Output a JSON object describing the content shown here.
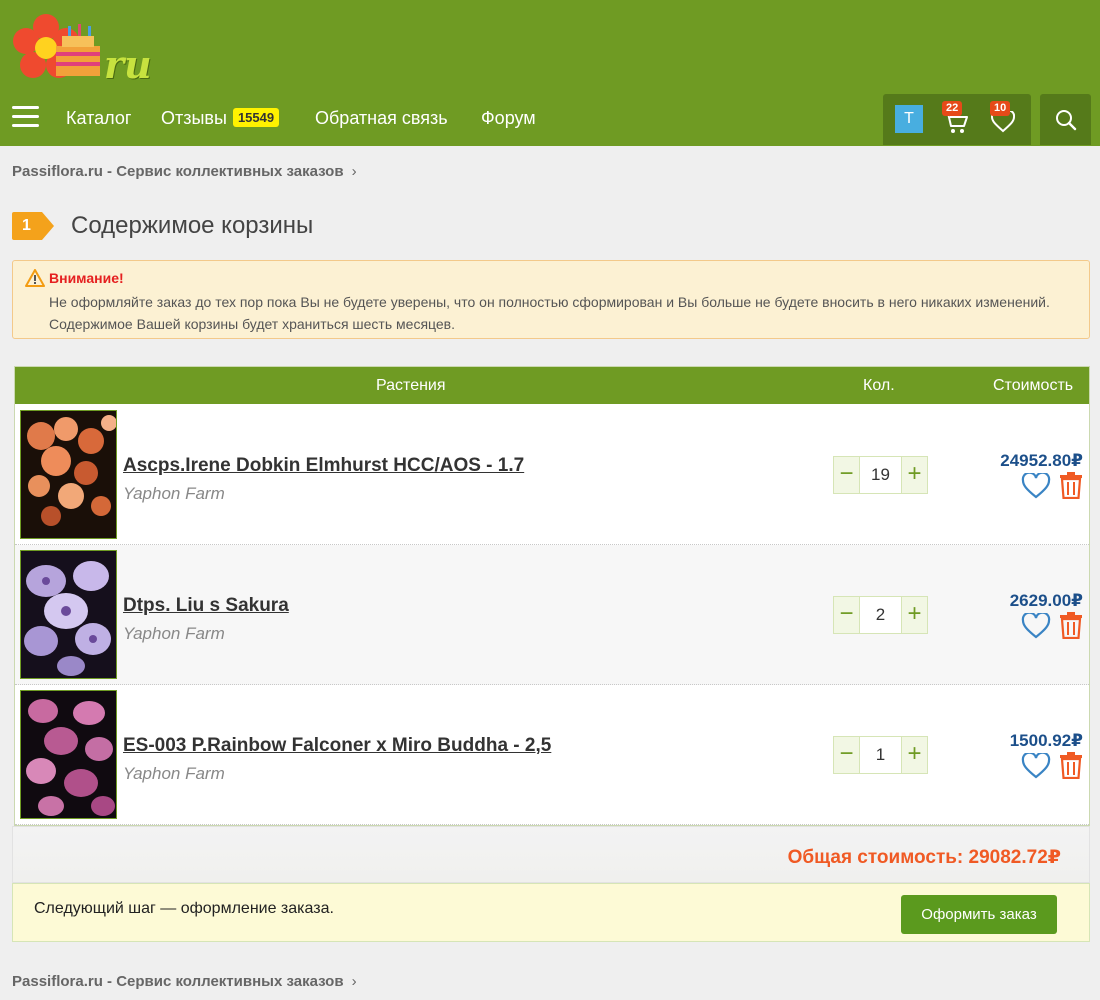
{
  "header": {
    "logo_text": "ru",
    "nav": {
      "catalog": "Каталог",
      "reviews": "Отзывы",
      "reviews_count": "15549",
      "feedback": "Обратная связь",
      "forum": "Форум"
    },
    "user_initial": "T",
    "cart_count": "22",
    "favorites_count": "10"
  },
  "breadcrumb": {
    "text": "Passiflora.ru - Сервис коллективных заказов",
    "sep": "›"
  },
  "step": {
    "number": "1",
    "title": "Содержимое корзины"
  },
  "warning": {
    "title": "Внимание!",
    "text": "Не оформляйте заказ до тех пор пока Вы не будете уверены, что он полностью сформирован и Вы больше не будете вносить в него никаких изменений. Содержимое Вашей корзины будет храниться шесть месяцев."
  },
  "cart": {
    "columns": {
      "plants": "Растения",
      "qty": "Кол.",
      "cost": "Стоимость"
    },
    "items": [
      {
        "name": "Ascps.Irene Dobkin Elmhurst HCC/AOS - 1.7",
        "farm": "Yaphon Farm",
        "qty": "19",
        "price": "24952.80₽"
      },
      {
        "name": "Dtps. Liu s Sakura",
        "farm": "Yaphon Farm",
        "qty": "2",
        "price": "2629.00₽"
      },
      {
        "name": "ES-003 P.Rainbow Falconer x Miro Buddha - 2,5",
        "farm": "Yaphon Farm",
        "qty": "1",
        "price": "1500.92₽"
      }
    ],
    "total": "Общая стоимость: 29082.72₽"
  },
  "next_step": {
    "text": "Следующий шаг — оформление заказа.",
    "button": "Оформить заказ"
  },
  "colors": {
    "header_green": "#6f9b23",
    "price_blue": "#1c4f8a",
    "total_orange": "#f05a24",
    "delete_orange": "#f05a24",
    "order_button": "#5b9a1e"
  }
}
